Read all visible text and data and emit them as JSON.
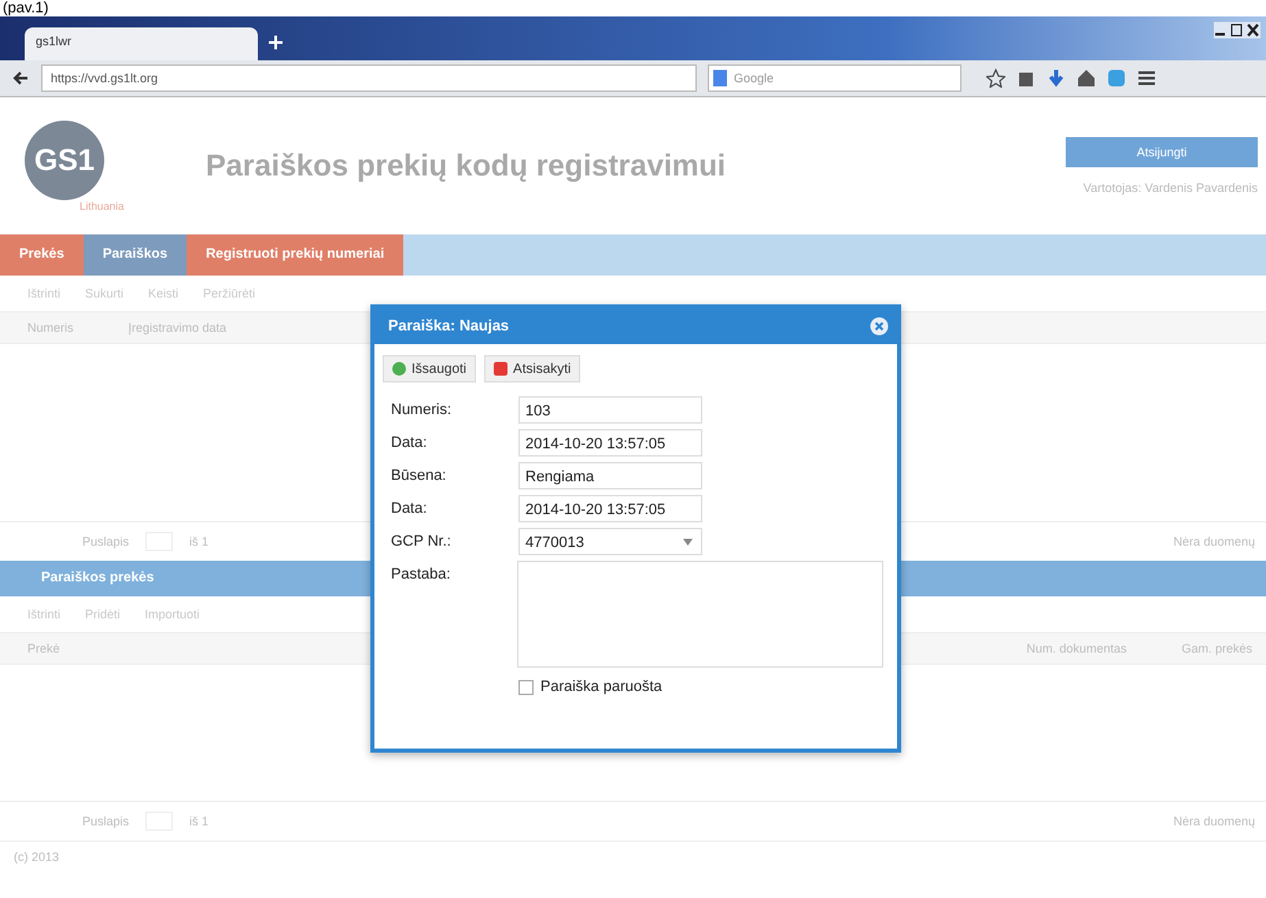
{
  "caption": "(pav.1)",
  "browser": {
    "tab_title": "gs1lwr",
    "url": "https://vvd.gs1lt.org",
    "search_placeholder": "Google"
  },
  "header": {
    "logo": "GS1",
    "logo_sub": "Lithuania",
    "title": "Paraiškos prekių kodų registravimui",
    "logout_button": "Atsijungti",
    "user": "Vartotojas: Vardenis Pavardenis"
  },
  "nav": [
    {
      "label": "Prekės",
      "selected": false
    },
    {
      "label": "Paraiškos",
      "selected": true
    },
    {
      "label": "Registruoti prekių numeriai",
      "selected": false
    }
  ],
  "top_grid": {
    "toolbar": [
      "Ištrinti",
      "Sukurti",
      "Keisti",
      "Peržiūrėti"
    ],
    "columns": [
      "Numeris",
      "Įregistravimo data"
    ],
    "pager": {
      "page_label": "Puslapis",
      "of": "iš 1",
      "empty": "Nėra duomenų"
    }
  },
  "items_panel": {
    "title": "Paraiškos prekės",
    "toolbar": [
      "Ištrinti",
      "Pridėti",
      "Importuoti"
    ],
    "columns": [
      "Prekė",
      "Num. dokumentas",
      "Gam. prekės"
    ],
    "pager": {
      "page_label": "Puslapis",
      "of": "iš 1",
      "empty": "Nėra duomenų"
    }
  },
  "footer": "(c) 2013",
  "dialog": {
    "title": "Paraiška: Naujas",
    "buttons": [
      {
        "label": "Išsaugoti",
        "kind": "save"
      },
      {
        "label": "Atsisakyti",
        "kind": "cancel"
      }
    ],
    "fields": [
      {
        "label": "Numeris:",
        "value": "103",
        "kind": "text"
      },
      {
        "label": "Data:",
        "value": "2014-10-20 13:57:05",
        "kind": "text"
      },
      {
        "label": "Būsena:",
        "value": "Rengiama",
        "kind": "text"
      },
      {
        "label": "Data:",
        "value": "2014-10-20 13:57:05",
        "kind": "text"
      },
      {
        "label": "GCP Nr.:",
        "value": "4770013",
        "kind": "select"
      },
      {
        "label": "Pastaba:",
        "kind": "textarea"
      }
    ],
    "checkbox": {
      "label": "Paraiška paruošta",
      "checked": false
    }
  }
}
